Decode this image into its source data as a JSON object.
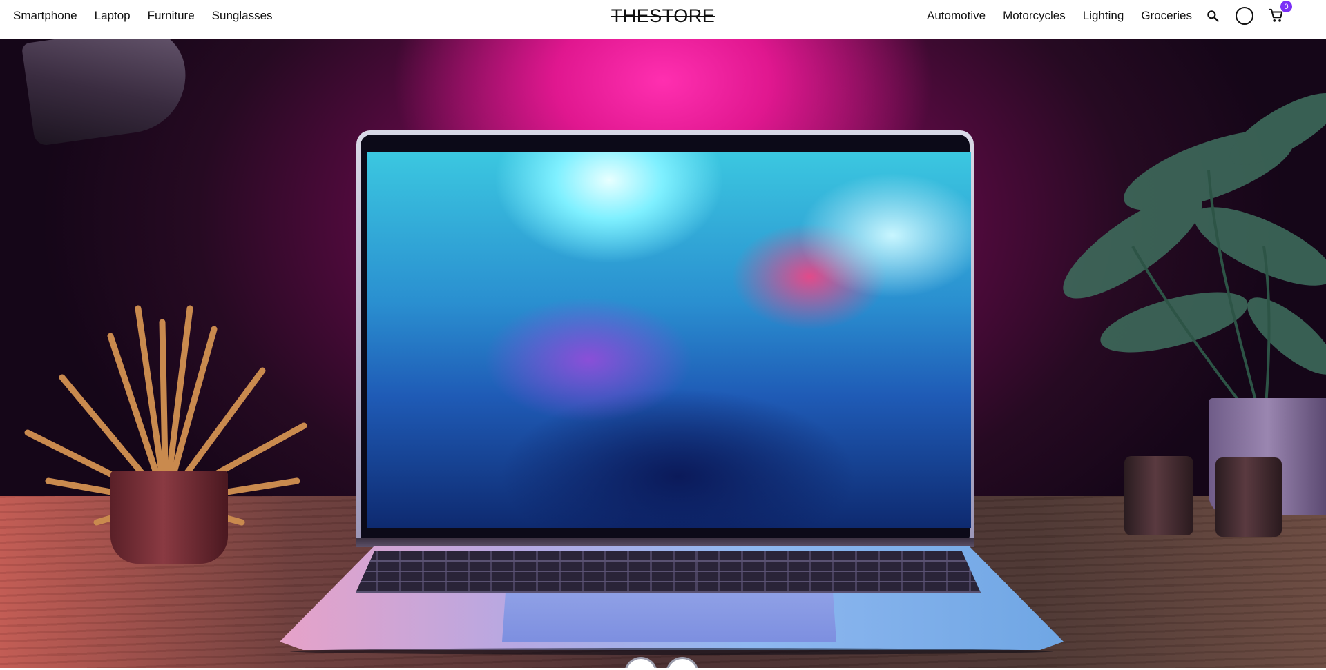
{
  "header": {
    "nav_left": [
      "Smartphone",
      "Laptop",
      "Furniture",
      "Sunglasses"
    ],
    "logo": "THESTORE",
    "nav_right": [
      "Automotive",
      "Motorcycles",
      "Lighting",
      "Groceries"
    ],
    "icons": {
      "search": "search-icon",
      "user": "user-icon",
      "cart": "cart-icon"
    },
    "cart_count": "0"
  },
  "hero": {
    "slider": {
      "prev": "arrow-left-icon",
      "next": "arrow-right-icon"
    }
  },
  "colors": {
    "accent": "#7b2ff7",
    "header_bg": "#ffffff",
    "text": "#111111"
  }
}
